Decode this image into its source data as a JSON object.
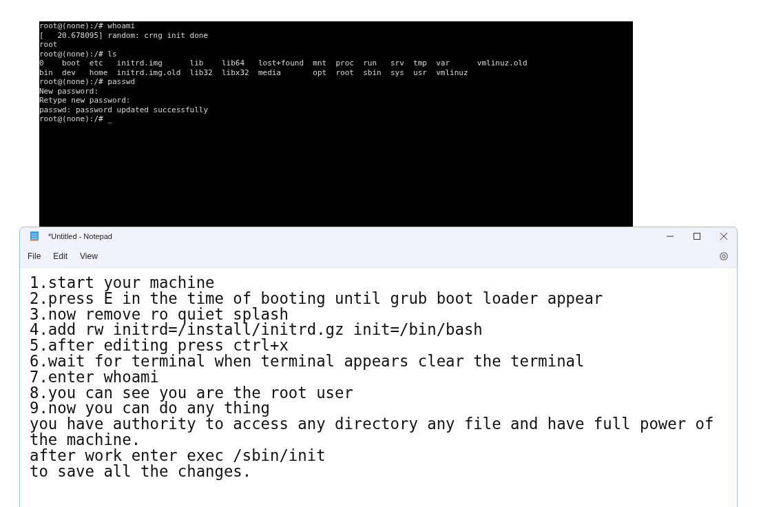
{
  "terminal": {
    "lines": [
      "root@(none):/# whoami",
      "[   20.678095] random: crng init done",
      "root",
      "root@(none):/# ls",
      "0    boot  etc   initrd.img      lib    lib64   lost+found  mnt  proc  run   srv  tmp  var      vmlinuz.old",
      "bin  dev   home  initrd.img.old  lib32  libx32  media       opt  root  sbin  sys  usr  vmlinuz",
      "root@(none):/# passwd",
      "New password:",
      "Retype new password:",
      "passwd: password updated successfully",
      "root@(none):/# _"
    ]
  },
  "notepad": {
    "title": "*Untitled - Notepad",
    "menu": [
      "File",
      "Edit",
      "View"
    ],
    "lines": [
      "1.start your machine",
      "2.press E in the time of booting until grub boot loader appear",
      "3.now remove ro quiet splash",
      "4.add rw initrd=/install/initrd.gz init=/bin/bash",
      "5.after editing press ctrl+x",
      "6.wait for terminal when terminal appears clear the terminal",
      "7.enter whoami",
      "8.you can see you are the root user",
      "9.now you can do any thing",
      "you have authority to access any directory any file and have full power of the machine.",
      "after work enter exec /sbin/init",
      "to save all the changes."
    ]
  }
}
